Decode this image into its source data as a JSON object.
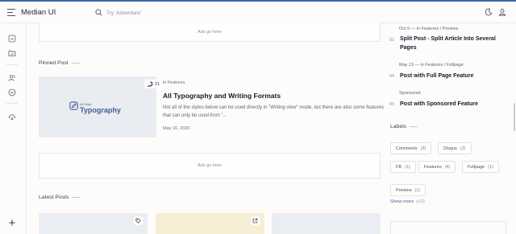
{
  "header": {
    "brand": "Median UI",
    "search_placeholder": "Try 'Adventure'"
  },
  "main": {
    "ad_top": "Ads go here",
    "pinned_title": "Pinned Post",
    "pinned": {
      "thumb_small": "All Style",
      "thumb_big": "Typography",
      "comments": "21",
      "category": "in Features",
      "title": "All Typography and Writing Formats",
      "snippet": "Not all of the styles below can be used directly in \"Writing view\" mode, but there are also some features that can only be used from \"...",
      "date": "May 16, 2020"
    },
    "ad_middle": "Ads go here",
    "latest_title": "Latest Posts"
  },
  "right": {
    "posts": [
      {
        "meta": "Oct 6 — in Features / Preview",
        "num": "03",
        "title": "Split Post - Split Article Into Several Pages"
      },
      {
        "meta": "May 13 — in Features / Fullpage",
        "num": "04",
        "title": "Post with Full Page Feature"
      },
      {
        "meta": "Sponsored",
        "num": "05",
        "title": "Post with Sponsored Feature"
      }
    ],
    "labels_title": "Labels",
    "labels": [
      {
        "name": "Comments",
        "count": "(3)"
      },
      {
        "name": "Disqus",
        "count": "(2)"
      },
      {
        "name": "FB",
        "count": "(1)"
      },
      {
        "name": "Features",
        "count": "(4)"
      },
      {
        "name": "Fullpage",
        "count": "(1)"
      },
      {
        "name": "Preview",
        "count": "(1)"
      }
    ],
    "show_more": "Show more",
    "show_more_count": "(+2)"
  },
  "icons": {
    "menu": "hamburger-icon",
    "search": "search-icon",
    "theme": "moon-icon",
    "user": "user-icon"
  },
  "colors": {
    "accent": "#3d6aa8",
    "thumb_bg": "#e9edf2",
    "card_yellow": "#f6efd6"
  }
}
